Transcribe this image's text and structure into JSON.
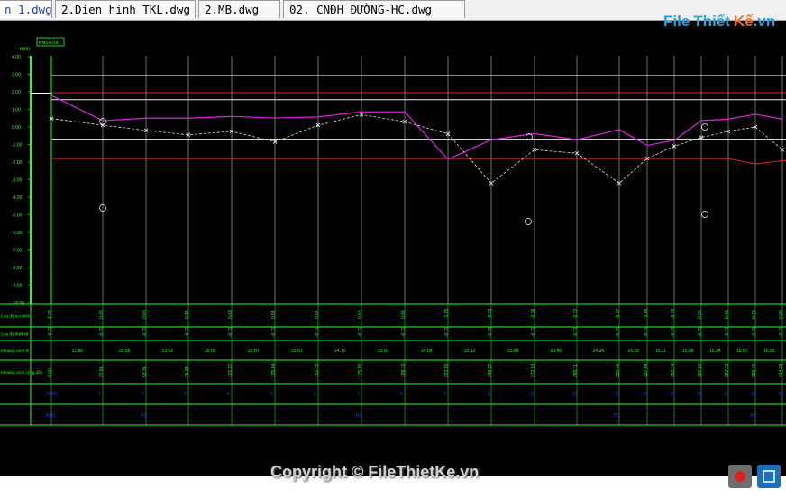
{
  "tabs": [
    {
      "label": "n 1.dwg",
      "active": true
    },
    {
      "label": "2.Dien hinh TKL.dwg",
      "active": false
    },
    {
      "label": "2.MB.dwg",
      "active": false
    },
    {
      "label": "02. CNĐH ĐƯỜNG-HC.dwg",
      "active": false
    }
  ],
  "logo": {
    "file": "File",
    "thiet": "Thiết",
    "ke": "Kế",
    "dot": ".vn"
  },
  "watermark": "Copyright © FileThietKe.vn",
  "drawing": {
    "yaxis_title": "H(m)",
    "km_label": "KM0+0.00",
    "yticks": [
      "4.00",
      "3.00",
      "2.00",
      "1.00",
      "0.00",
      "-1.00",
      "-2.00",
      "-3.00",
      "-4.00",
      "-5.00",
      "-6.00",
      "-7.00",
      "-8.00",
      "-9.00",
      "-10.00"
    ],
    "row_labels": [
      "Cao độ tự nhiên",
      "Cao độ thiết kế",
      "Khoảng cách lẻ",
      "Khoảng cách cộng dồn",
      "",
      ""
    ],
    "row1_values": [
      "1.79",
      "0.36",
      "0.60",
      "0.36",
      "0.63",
      "0.51",
      "0.57",
      "0.66",
      "0.86",
      "-1.85",
      "-0.73",
      "-0.38",
      "-0.72",
      "-0.97",
      "-1.05",
      "-0.76",
      "0.36",
      "0.45",
      "0.72",
      "0.30"
    ],
    "row2_values": [
      "-0.70",
      "-0.70",
      "-0.70",
      "-0.70",
      "-0.70",
      "-0.70",
      "-0.70",
      "-0.70",
      "-0.70",
      "-0.70",
      "-0.70",
      "-0.70",
      "-0.70",
      "-0.70",
      "-0.70",
      "-0.70",
      "-0.70",
      "-0.70",
      "-0.70",
      "-0.70"
    ],
    "row3_values": [
      "27.86",
      "25.56",
      "23.62",
      "25.09",
      "25.87",
      "23.51",
      "24.70",
      "23.91",
      "24.09",
      "25.12",
      "23.86",
      "23.49",
      "24.34",
      "16.56",
      "15.11",
      "15.08",
      "15.34",
      "15.67",
      "15.95"
    ],
    "row4_values": [
      "0.00",
      "27.86",
      "53.36",
      "76.85",
      "101.97",
      "125.64",
      "151.15",
      "175.85",
      "199.76",
      "223.85",
      "248.97",
      "272.83",
      "296.11",
      "320.45",
      "337.04",
      "352.14",
      "367.20",
      "382.73",
      "398.41",
      "414.29"
    ],
    "row5_values": [
      "KM0+",
      "1",
      "2",
      "3",
      "4",
      "5",
      "6",
      "7",
      "8",
      "9",
      "10",
      "11",
      "12",
      "13",
      "14",
      "15",
      "16",
      "17",
      "18",
      "19"
    ],
    "row6_values": [
      "KM0",
      "",
      "H1",
      "",
      "",
      "",
      "",
      "H2",
      "",
      "",
      "",
      "",
      "",
      "H3",
      "",
      "",
      "",
      "",
      "H4",
      ""
    ],
    "vline_x": [
      57,
      114,
      162,
      209,
      257,
      305,
      353,
      401,
      449,
      497,
      545,
      593,
      640,
      687,
      718,
      748,
      778,
      808,
      838,
      868
    ],
    "natural_h": [
      1.79,
      0.36,
      0.5,
      0.5,
      0.6,
      0.51,
      0.57,
      0.86,
      0.86,
      -1.85,
      -0.73,
      -0.38,
      -0.72,
      -0.15,
      -1.05,
      -0.76,
      0.36,
      0.45,
      0.72,
      0.45
    ],
    "design_h": [
      0.48,
      0.1,
      -0.2,
      -0.45,
      -0.25,
      -0.85,
      0.1,
      0.7,
      0.3,
      -0.4,
      -3.2,
      -1.3,
      -1.5,
      -3.2,
      -1.8,
      -1.1,
      -0.6,
      -0.25,
      0.0,
      -1.3
    ],
    "ref_h": {
      "cyan": 2.95,
      "red": 1.95,
      "white1": 1.55,
      "white2": -0.7,
      "red2": -1.8
    }
  }
}
